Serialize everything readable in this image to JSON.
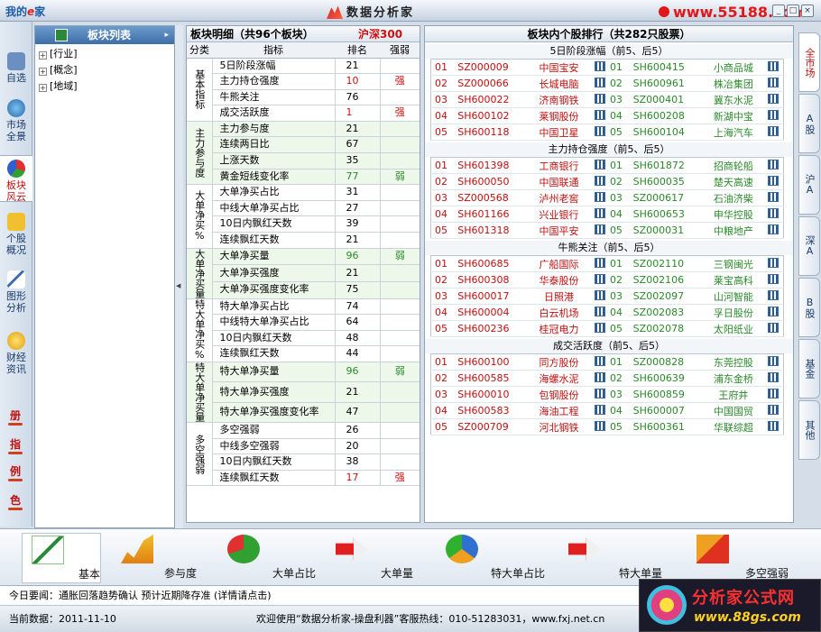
{
  "titlebar": {
    "logo_text": "我的",
    "logo_e": "e",
    "logo_suffix": "家",
    "app_title": "数据分析家",
    "url": "www.55188.com",
    "win_min": "_",
    "win_max": "□",
    "win_close": "×"
  },
  "leftnav": {
    "items": [
      {
        "label": "自选"
      },
      {
        "label": "市场全景"
      },
      {
        "label": "板块风云"
      },
      {
        "label": "个股概况"
      },
      {
        "label": "图形分析"
      },
      {
        "label": "财经资讯"
      }
    ],
    "col_buttons": [
      "册",
      "指",
      "例",
      "色"
    ]
  },
  "tree": {
    "title": "板块列表",
    "arrow": "▸",
    "nodes": [
      "[行业]",
      "[概念]",
      "[地域]"
    ]
  },
  "detail": {
    "title": "板块明细（共96个板块）",
    "market": "沪深300",
    "headers": {
      "cat": "分类",
      "ind": "指标",
      "rank": "排名",
      "strong": "强弱"
    },
    "groups": [
      {
        "name": "基本指标",
        "rows": [
          {
            "ind": "5日阶段涨幅",
            "rank": "21",
            "rk": "n",
            "st": ""
          },
          {
            "ind": "主力持仓强度",
            "rank": "10",
            "rk": "r",
            "st": "强"
          },
          {
            "ind": "牛熊关注",
            "rank": "76",
            "rk": "n",
            "st": ""
          },
          {
            "ind": "成交活跃度",
            "rank": "1",
            "rk": "r",
            "st": "强"
          }
        ]
      },
      {
        "name": "主力参与度",
        "rows": [
          {
            "ind": "主力参与度",
            "rank": "21",
            "rk": "n",
            "st": ""
          },
          {
            "ind": "连续两日比",
            "rank": "67",
            "rk": "n",
            "st": ""
          },
          {
            "ind": "上涨天数",
            "rank": "35",
            "rk": "n",
            "st": ""
          },
          {
            "ind": "黄金短线变化率",
            "rank": "77",
            "rk": "g",
            "st": "弱"
          }
        ]
      },
      {
        "name": "大单净买%",
        "rows": [
          {
            "ind": "大单净买占比",
            "rank": "31",
            "rk": "n",
            "st": ""
          },
          {
            "ind": "中线大单净买占比",
            "rank": "27",
            "rk": "n",
            "st": ""
          },
          {
            "ind": "10日内飘红天数",
            "rank": "39",
            "rk": "n",
            "st": ""
          },
          {
            "ind": "连续飘红天数",
            "rank": "21",
            "rk": "n",
            "st": ""
          }
        ]
      },
      {
        "name": "大单净买量",
        "rows": [
          {
            "ind": "大单净买量",
            "rank": "96",
            "rk": "g",
            "st": "弱"
          },
          {
            "ind": "大单净买强度",
            "rank": "21",
            "rk": "n",
            "st": ""
          },
          {
            "ind": "大单净买强度变化率",
            "rank": "75",
            "rk": "n",
            "st": ""
          }
        ]
      },
      {
        "name": "特大单净买%",
        "rows": [
          {
            "ind": "特大单净买占比",
            "rank": "74",
            "rk": "n",
            "st": ""
          },
          {
            "ind": "中线特大单净买占比",
            "rank": "64",
            "rk": "n",
            "st": ""
          },
          {
            "ind": "10日内飘红天数",
            "rank": "48",
            "rk": "n",
            "st": ""
          },
          {
            "ind": "连续飘红天数",
            "rank": "44",
            "rk": "n",
            "st": ""
          }
        ]
      },
      {
        "name": "特大单净买量",
        "rows": [
          {
            "ind": "特大单净买量",
            "rank": "96",
            "rk": "g",
            "st": "弱"
          },
          {
            "ind": "特大单净买强度",
            "rank": "21",
            "rk": "n",
            "st": ""
          },
          {
            "ind": "特大单净买强度变化率",
            "rank": "47",
            "rk": "n",
            "st": ""
          }
        ]
      },
      {
        "name": "多空强弱",
        "rows": [
          {
            "ind": "多空强弱",
            "rank": "26",
            "rk": "n",
            "st": ""
          },
          {
            "ind": "中线多空强弱",
            "rank": "20",
            "rk": "n",
            "st": ""
          },
          {
            "ind": "10日内飘红天数",
            "rank": "38",
            "rk": "n",
            "st": ""
          },
          {
            "ind": "连续飘红天数",
            "rank": "17",
            "rk": "r",
            "st": "强"
          }
        ]
      }
    ]
  },
  "ranking": {
    "title": "板块内个股排行（共282只股票）",
    "sections": [
      {
        "title": "5日阶段涨幅（前5、后5）",
        "rows": [
          [
            "01",
            "SZ000009",
            "中国宝安",
            "01",
            "SH600415",
            "小商品城"
          ],
          [
            "02",
            "SZ000066",
            "长城电脑",
            "02",
            "SH600961",
            "株冶集团"
          ],
          [
            "03",
            "SH600022",
            "济南钢铁",
            "03",
            "SZ000401",
            "冀东水泥"
          ],
          [
            "04",
            "SH600102",
            "莱钢股份",
            "04",
            "SH600208",
            "新湖中宝"
          ],
          [
            "05",
            "SH600118",
            "中国卫星",
            "05",
            "SH600104",
            "上海汽车"
          ]
        ]
      },
      {
        "title": "主力持仓强度（前5、后5）",
        "rows": [
          [
            "01",
            "SH601398",
            "工商银行",
            "01",
            "SH601872",
            "招商轮船"
          ],
          [
            "02",
            "SH600050",
            "中国联通",
            "02",
            "SH600035",
            "楚天高速"
          ],
          [
            "03",
            "SZ000568",
            "泸州老窖",
            "03",
            "SZ000617",
            "石油济柴"
          ],
          [
            "04",
            "SH601166",
            "兴业银行",
            "04",
            "SH600653",
            "申华控股"
          ],
          [
            "05",
            "SH601318",
            "中国平安",
            "05",
            "SZ000031",
            "中粮地产"
          ]
        ]
      },
      {
        "title": "牛熊关注（前5、后5）",
        "rows": [
          [
            "01",
            "SH600685",
            "广船国际",
            "01",
            "SZ002110",
            "三钢闽光"
          ],
          [
            "02",
            "SH600308",
            "华泰股份",
            "02",
            "SZ002106",
            "莱宝高科"
          ],
          [
            "03",
            "SH600017",
            "日照港",
            "03",
            "SZ002097",
            "山河智能"
          ],
          [
            "04",
            "SH600004",
            "白云机场",
            "04",
            "SZ002083",
            "孚日股份"
          ],
          [
            "05",
            "SH600236",
            "桂冠电力",
            "05",
            "SZ002078",
            "太阳纸业"
          ]
        ]
      },
      {
        "title": "成交活跃度（前5、后5）",
        "rows": [
          [
            "01",
            "SH600100",
            "同方股份",
            "01",
            "SZ000828",
            "东莞控股"
          ],
          [
            "02",
            "SH600585",
            "海螺水泥",
            "02",
            "SH600639",
            "浦东金桥"
          ],
          [
            "03",
            "SH600010",
            "包钢股份",
            "03",
            "SH600859",
            "王府井"
          ],
          [
            "04",
            "SH600583",
            "海油工程",
            "04",
            "SH600007",
            "中国国贸"
          ],
          [
            "05",
            "SZ000709",
            "河北钢铁",
            "05",
            "SH600361",
            "华联综超"
          ]
        ]
      }
    ]
  },
  "vtabs": [
    "全市场",
    "A股",
    "沪A",
    "深A",
    "B股",
    "基金",
    "其他"
  ],
  "toolbar": [
    "基本",
    "参与度",
    "大单占比",
    "大单量",
    "特大单占比",
    "特大单量",
    "多空强弱"
  ],
  "news": "今日要闻：通胀回落趋势确认 预计近期降存准 (详情请点击)",
  "status": {
    "current_date": "当前数据：2011-11-10",
    "welcome": "欢迎使用“数据分析家-操盘利器”客服热线：010-51283031，www.fxj.net.cn"
  },
  "corner": {
    "t1": "分析家公式网",
    "t2": "www.88gs.com"
  },
  "colors": {
    "red": "#d01010",
    "green": "#2a8a2a",
    "header_blue": "#3d6ea8"
  }
}
